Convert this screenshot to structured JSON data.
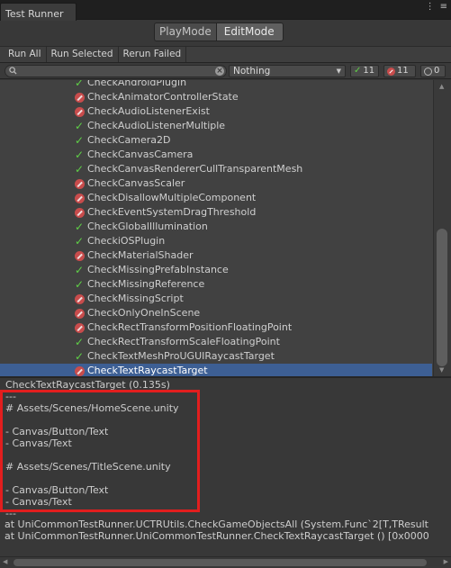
{
  "window": {
    "tab_title": "Test Runner",
    "menu_icon": "kebab-menu-icon",
    "close_icon": "close-icon"
  },
  "mode": {
    "play_label": "PlayMode",
    "edit_label": "EditMode",
    "active": "EditMode"
  },
  "toolbar": {
    "run_all": "Run All",
    "run_selected": "Run Selected",
    "rerun_failed": "Rerun Failed"
  },
  "filter": {
    "search_value": "",
    "category_value": "Nothing",
    "passed_count": "11",
    "failed_count": "11",
    "skipped_count": "0"
  },
  "colors": {
    "pass": "#5fcf47",
    "fail": "#c84c4c",
    "selection": "#3d5f94",
    "highlight_box": "#e21e1e"
  },
  "tests": [
    {
      "name": "CheckAndroidPlugin",
      "status": "pass"
    },
    {
      "name": "CheckAnimatorControllerState",
      "status": "fail"
    },
    {
      "name": "CheckAudioListenerExist",
      "status": "fail"
    },
    {
      "name": "CheckAudioListenerMultiple",
      "status": "pass"
    },
    {
      "name": "CheckCamera2D",
      "status": "pass"
    },
    {
      "name": "CheckCanvasCamera",
      "status": "pass"
    },
    {
      "name": "CheckCanvasRendererCullTransparentMesh",
      "status": "pass"
    },
    {
      "name": "CheckCanvasScaler",
      "status": "fail"
    },
    {
      "name": "CheckDisallowMultipleComponent",
      "status": "fail"
    },
    {
      "name": "CheckEventSystemDragThreshold",
      "status": "fail"
    },
    {
      "name": "CheckGlobalIllumination",
      "status": "pass"
    },
    {
      "name": "CheckiOSPlugin",
      "status": "pass"
    },
    {
      "name": "CheckMaterialShader",
      "status": "fail"
    },
    {
      "name": "CheckMissingPrefabInstance",
      "status": "pass"
    },
    {
      "name": "CheckMissingReference",
      "status": "pass"
    },
    {
      "name": "CheckMissingScript",
      "status": "fail"
    },
    {
      "name": "CheckOnlyOneInScene",
      "status": "fail"
    },
    {
      "name": "CheckRectTransformPositionFloatingPoint",
      "status": "fail"
    },
    {
      "name": "CheckRectTransformScaleFloatingPoint",
      "status": "pass"
    },
    {
      "name": "CheckTextMeshProUGUIRaycastTarget",
      "status": "pass"
    },
    {
      "name": "CheckTextRaycastTarget",
      "status": "fail",
      "selected": true
    }
  ],
  "details": {
    "header": "CheckTextRaycastTarget (0.135s)",
    "lines": [
      "---",
      "# Assets/Scenes/HomeScene.unity",
      "",
      "- Canvas/Button/Text",
      "- Canvas/Text",
      "",
      "# Assets/Scenes/TitleScene.unity",
      "",
      "- Canvas/Button/Text",
      "- Canvas/Text",
      "---"
    ],
    "stack": [
      "at UniCommonTestRunner.UCTRUtils.CheckGameObjectsAll (System.Func`2[T,TResult",
      "at UniCommonTestRunner.UniCommonTestRunner.CheckTextRaycastTarget () [0x0000"
    ]
  }
}
